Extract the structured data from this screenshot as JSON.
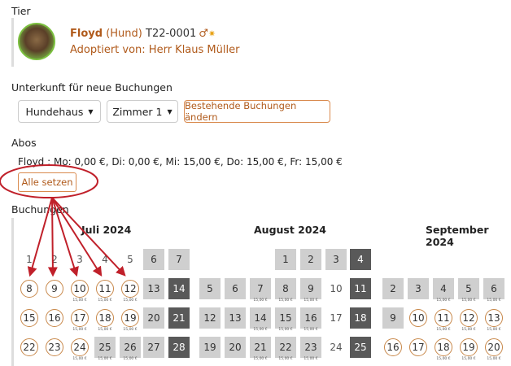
{
  "sections": {
    "tier": "Tier",
    "unterkunft": "Unterkunft für neue Buchungen",
    "abos": "Abos",
    "buchungen": "Buchungen"
  },
  "pet": {
    "name": "Floyd",
    "type": "(Hund)",
    "id": "T22-0001",
    "sex_symbol": "♂",
    "adopted": "Adoptiert von: Herr Klaus Müller"
  },
  "unterkunft": {
    "house": "Hundehaus",
    "room": "Zimmer 1",
    "change_button": "Bestehende Buchungen ändern"
  },
  "abos": {
    "text": "Floyd : Mo: 0,00 €, Di: 0,00 €, Mi: 15,00 €, Do: 15,00 €, Fr: 15,00 €",
    "set_all_button": "Alle setzen"
  },
  "calendar": {
    "months": [
      "Juli 2024",
      "August 2024",
      "September 2024"
    ],
    "price_label": "15,00 €",
    "colors": {
      "ring": "#c8884a",
      "weekend": "#cfcfcf",
      "blocked": "#595959",
      "accent": "#b05a1b",
      "annotation": "#c0202a"
    }
  }
}
